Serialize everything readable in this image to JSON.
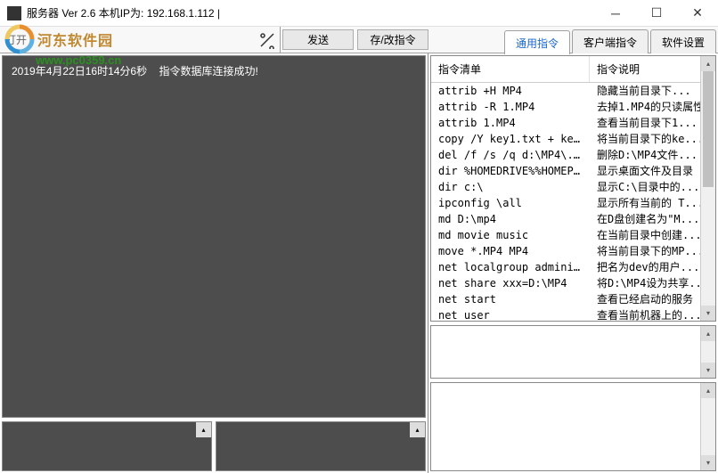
{
  "window": {
    "title": "服务器 Ver 2.6 本机IP为: 192.168.1.112 |"
  },
  "toolbar": {
    "open_label": "打开",
    "input_value": "",
    "send_label": "发送",
    "save_label": "存/改指令"
  },
  "tabs": {
    "items": [
      {
        "label": "通用指令",
        "active": true
      },
      {
        "label": "客户端指令",
        "active": false
      },
      {
        "label": "软件设置",
        "active": false
      }
    ]
  },
  "log": {
    "lines": [
      {
        "time": "2019年4月22日16时14分6秒",
        "msg": "指令数据库连接成功!"
      }
    ]
  },
  "cmd_headers": {
    "col1": "指令清单",
    "col2": "指令说明"
  },
  "commands": [
    {
      "cmd": "attrib +H MP4",
      "desc": "隐藏当前目录下..."
    },
    {
      "cmd": "attrib -R 1.MP4",
      "desc": "去掉1.MP4的只读属性"
    },
    {
      "cmd": "attrib 1.MP4",
      "desc": "查看当前目录下1..."
    },
    {
      "cmd": "copy /Y key1.txt + key...",
      "desc": "将当前目录下的ke..."
    },
    {
      "cmd": "del /f /s /q   d:\\MP4\\...",
      "desc": "删除D:\\MP4文件..."
    },
    {
      "cmd": "dir %HOMEDRIVE%%HOMEPA...",
      "desc": "显示桌面文件及目录"
    },
    {
      "cmd": "dir c:\\",
      "desc": "显示C:\\目录中的..."
    },
    {
      "cmd": "ipconfig \\all",
      "desc": "显示所有当前的 T..."
    },
    {
      "cmd": "md D:\\mp4",
      "desc": "在D盘创建名为\"M..."
    },
    {
      "cmd": "md movie music",
      "desc": "在当前目录中创建..."
    },
    {
      "cmd": "move *.MP4 MP4",
      "desc": "将当前目录下的MP..."
    },
    {
      "cmd": "net localgroup adminis...",
      "desc": "把名为dev的用户..."
    },
    {
      "cmd": "net share xxx=D:\\MP4",
      "desc": "将D:\\MP4设为共享..."
    },
    {
      "cmd": "net start",
      "desc": "查看已经启动的服务"
    },
    {
      "cmd": "net user",
      "desc": "查看当前机器上的..."
    }
  ],
  "watermark": {
    "brand": "河东软件园",
    "url": "www.pc0359.cn"
  }
}
